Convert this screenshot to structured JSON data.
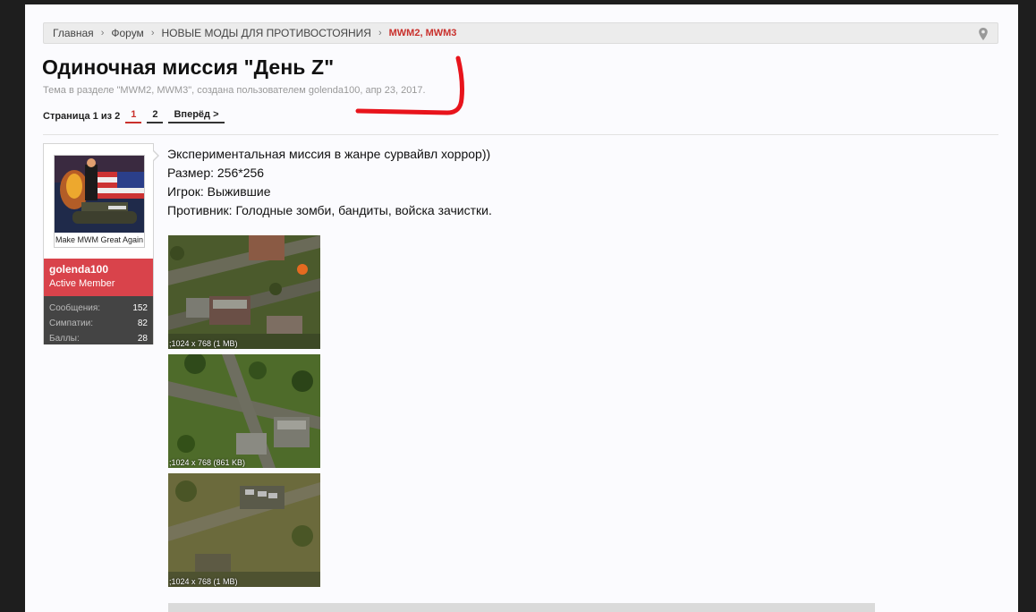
{
  "breadcrumb": {
    "items": [
      "Главная",
      "Форум",
      "НОВЫЕ МОДЫ ДЛЯ ПРОТИВОСТОЯНИЯ"
    ],
    "current": "MWM2, MWM3",
    "separator": "›"
  },
  "thread": {
    "title": "Одиночная миссия \"День Z\"",
    "meta": "Тема в разделе \"MWM2, MWM3\", создана пользователем golenda100, апр 23, 2017."
  },
  "pagenav": {
    "label": "Страница 1 из 2",
    "pages": [
      "1",
      "2"
    ],
    "next": "Вперёд >"
  },
  "user": {
    "avatar_caption": "Make MWM Great Again",
    "name": "golenda100",
    "role": "Active Member",
    "stats": [
      {
        "label": "Сообщения:",
        "value": "152"
      },
      {
        "label": "Симпатии:",
        "value": "82"
      },
      {
        "label": "Баллы:",
        "value": "28"
      }
    ]
  },
  "post": {
    "lines": [
      "Экспериментальная миссия в жанре сурвайвл хоррор))",
      "Размер: 256*256",
      "Игрок: Выжившие",
      "Противник: Голодные зомби, бандиты, войска зачистки."
    ],
    "attachments": [
      {
        "label": ";1024 x 768 (1 MB)"
      },
      {
        "label": ";1024 x 768 (861 KB)"
      },
      {
        "label": ";1024 x 768 (1 MB)"
      }
    ]
  },
  "colors": {
    "accent": "#c9302c",
    "user_band": "#d9434b",
    "stats_band": "#444444",
    "annotation": "#e8141c"
  }
}
